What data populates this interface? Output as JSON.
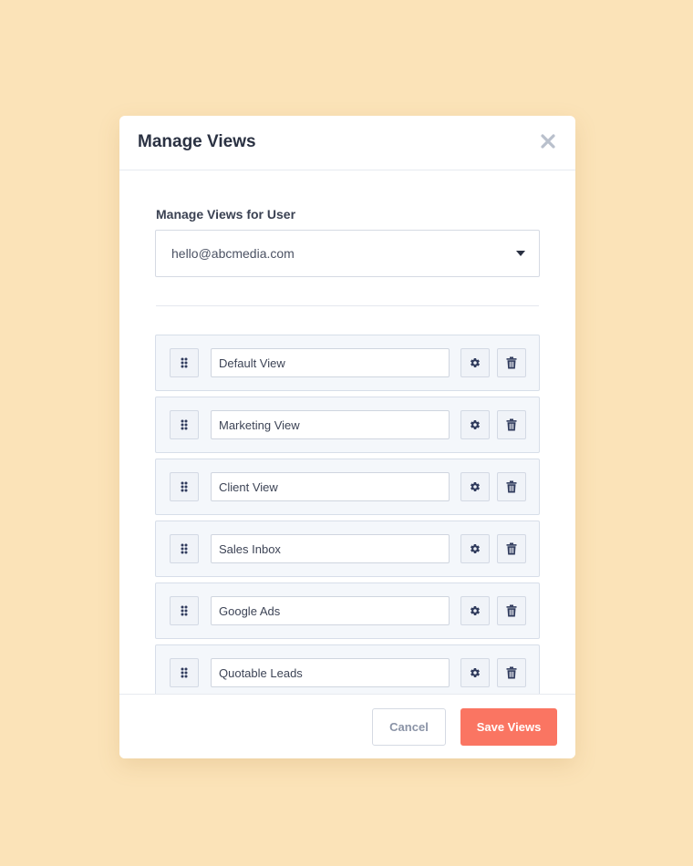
{
  "modal": {
    "title": "Manage Views"
  },
  "user_select": {
    "label": "Manage Views for User",
    "value": "hello@abcmedia.com"
  },
  "views": [
    {
      "name": "Default View"
    },
    {
      "name": "Marketing View"
    },
    {
      "name": "Client View"
    },
    {
      "name": "Sales Inbox"
    },
    {
      "name": "Google Ads"
    },
    {
      "name": "Quotable Leads"
    }
  ],
  "footer": {
    "cancel_label": "Cancel",
    "save_label": "Save Views"
  },
  "icons": {
    "close": "close-icon",
    "caret": "caret-down-icon",
    "drag": "drag-handle-icon",
    "settings": "gear-icon",
    "delete": "trash-icon"
  },
  "colors": {
    "background": "#fbe3b8",
    "primary_button": "#fa7562",
    "icon": "#2f3a5c"
  }
}
